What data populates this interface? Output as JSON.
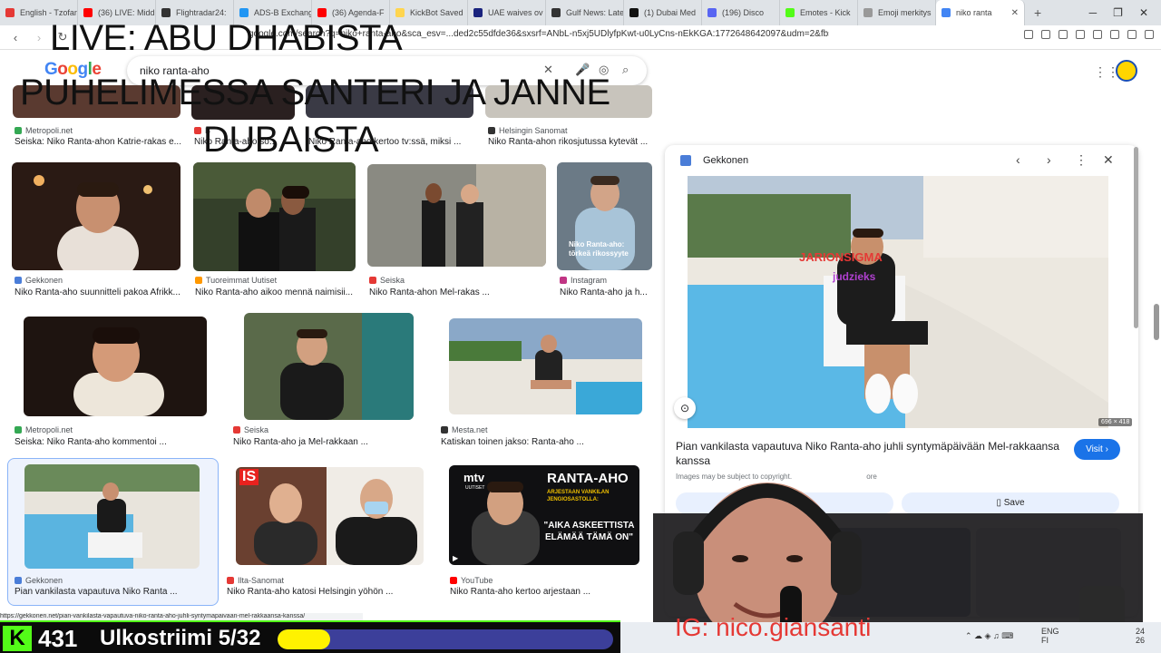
{
  "tabs": [
    {
      "label": "English - Tzofar",
      "color": "#e53935"
    },
    {
      "label": "(36) LIVE: Midd",
      "color": "#ff0000"
    },
    {
      "label": "Flightradar24:",
      "color": "#333333"
    },
    {
      "label": "ADS-B Exchang",
      "color": "#2196f3"
    },
    {
      "label": "(36) Agenda-F",
      "color": "#ff0000"
    },
    {
      "label": "KickBot Saved",
      "color": "#ffd54f"
    },
    {
      "label": "UAE waives ov",
      "color": "#1a237e"
    },
    {
      "label": "Gulf News: Late",
      "color": "#333333"
    },
    {
      "label": "(1) Dubai Med",
      "color": "#111111"
    },
    {
      "label": "(196) Disco",
      "color": "#5865f2"
    },
    {
      "label": "Emotes - Kick",
      "color": "#53fc18"
    },
    {
      "label": "Emoji merkitys",
      "color": "#999999"
    },
    {
      "label": "niko ranta",
      "color": "#4285f4"
    }
  ],
  "url": "google.com/search?q=niko+ranta-aho&sca_esv=...ded2c55dfde36&sxsrf=ANbL-n5xj5UDlyfpKwt-u0LyCns-nEkKGA:1772648642097&udm=2&fbs=ADc_l-aN0CWEZBO...",
  "google_logo": "Google",
  "search_query": "niko ranta-aho",
  "overlay_lines": [
    "LIVE: ABU DHABISTA",
    "PUHELIMESSA SANTERI JA JANNE",
    "DUBAISTA"
  ],
  "results_row0": [
    {
      "source": "Metropoli.net",
      "caption": "Seiska: Niko Ranta-ahon Katrie-rakas e...",
      "color": "#34a853"
    },
    {
      "source": "B",
      "caption": "Niko Ranta-aho so...",
      "color": "#e53935"
    },
    {
      "source": "",
      "caption": "Niko Ranta-aho kertoo tv:ssä, miksi ...",
      "color": "#999999"
    },
    {
      "source": "Helsingin Sanomat",
      "caption": "Niko Ranta-ahon rikosjutussa kytevät ...",
      "color": "#333333"
    }
  ],
  "results_row1": [
    {
      "source": "Gekkonen",
      "caption": "Niko Ranta-aho suunnitteli pakoa Afrikk...",
      "color": "#4a7dd8"
    },
    {
      "source": "Tuoreimmat Uutiset",
      "caption": "Niko Ranta-aho aikoo mennä naimisii...",
      "color": "#ff9800"
    },
    {
      "source": "Seiska",
      "caption": "Niko Ranta-ahon Mel-rakas ...",
      "color": "#e53935"
    },
    {
      "source": "Instagram",
      "caption": "Niko Ranta-aho ja h...",
      "color": "#c13584"
    }
  ],
  "row1_thumb_text": "Niko Ranta-aho: törkeä rikossyyte",
  "results_row2": [
    {
      "source": "Metropoli.net",
      "caption": "Seiska: Niko Ranta-aho kommentoi ...",
      "color": "#34a853"
    },
    {
      "source": "Seiska",
      "caption": "Niko Ranta-aho ja Mel-rakkaan ...",
      "color": "#e53935"
    },
    {
      "source": "Mesta.net",
      "caption": "Katiskan toinen jakso: Ranta-aho ...",
      "color": "#333333"
    }
  ],
  "results_row3": [
    {
      "source": "Gekkonen",
      "caption": "Pian vankilasta vapautuva Niko Ranta ...",
      "color": "#4a7dd8"
    },
    {
      "source": "Ilta-Sanomat",
      "caption": "Niko Ranta-aho katosi Helsingin yöhön ...",
      "color": "#e53935"
    },
    {
      "source": "YouTube",
      "caption": "Niko Ranta-aho kertoo arjestaan ...",
      "color": "#ff0000"
    }
  ],
  "is_logo": "IS",
  "mtv_thumb": {
    "brand": "mtv",
    "sub": "UUTISET",
    "title": "RANTA-AHO",
    "tag": "ARJESTAAN VANKILAN JENGIOSASTOLLA:",
    "quote": "\"AIKA ASKEETTISTA ELÄMÄÄ TÄMÄ ON\""
  },
  "panel": {
    "site": "Gekkonen",
    "title": "Pian vankilasta vapautuva Niko Ranta-aho juhli syntymäpäivään Mel-rakkaansa kanssa",
    "visit_label": "Visit",
    "copyright": "Images may be subject to copyright.",
    "learn_more": "ore",
    "save_label": "Save",
    "dimensions": "696 × 418",
    "img_overlay1": "JARIONSIGMA",
    "img_overlay2": "judzieks"
  },
  "status_url": "https://gekkonen.net/pian-vankilasta-vapautuva-niko-ranta-aho-juhli-syntymapaivaan-mel-rakkaansa-kanssa/",
  "stream": {
    "viewers": "431",
    "kick_logo": "K",
    "title": "Ulkostriimi 5/32",
    "progress": 0.156,
    "instagram": "IG: nico.giansanti"
  },
  "taskbar": {
    "lang1": "ENG",
    "lang2": "FI",
    "time": "24",
    "date": "26"
  },
  "colors": {
    "accent": "#1a73e8",
    "kick_green": "#53fc18",
    "progress_yellow": "#fff200",
    "progress_bg": "#3c3f9a"
  }
}
